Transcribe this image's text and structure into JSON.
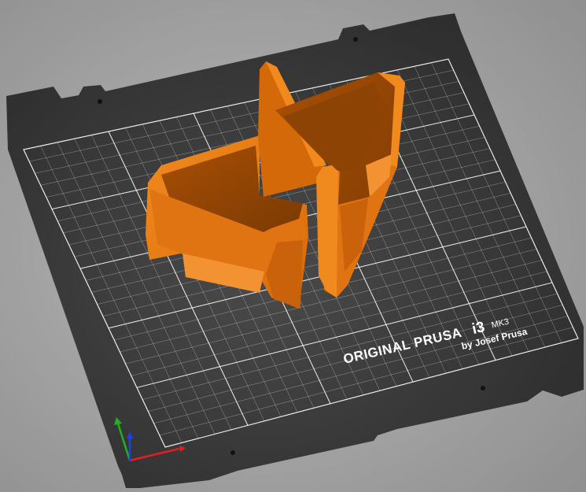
{
  "bed": {
    "brand_text": "ORIGINAL PRUSA",
    "model_text": "i3",
    "variant_text": "MK3",
    "maker_text": "by Josef Prusa"
  },
  "model": {
    "color": "#e87914"
  },
  "colors": {
    "background": "#a6a6a6",
    "bed": "#333333",
    "grid": "#ffffff",
    "axis_x": "#e02020",
    "axis_y": "#20b020",
    "axis_z": "#2040e0"
  }
}
